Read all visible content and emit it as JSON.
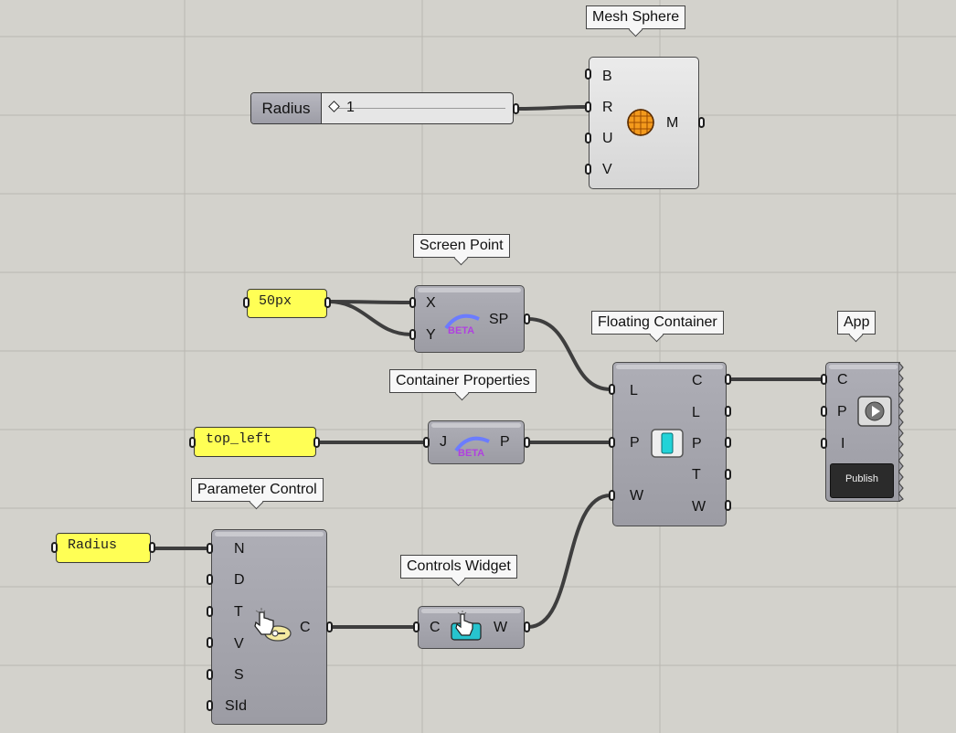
{
  "components": {
    "mesh_sphere": {
      "title": "Mesh Sphere",
      "inputs": [
        "B",
        "R",
        "U",
        "V"
      ],
      "outputs": [
        "M"
      ]
    },
    "radius_slider": {
      "label": "Radius",
      "value": "1"
    },
    "screen_point": {
      "title": "Screen Point",
      "inputs": [
        "X",
        "Y"
      ],
      "outputs": [
        "SP"
      ],
      "badge": "BETA"
    },
    "floating_container": {
      "title": "Floating Container",
      "inputs": [
        "L",
        "P",
        "W"
      ],
      "outputs": [
        "C",
        "L",
        "P",
        "T",
        "W"
      ]
    },
    "app": {
      "title": "App",
      "inputs": [
        "C",
        "P",
        "I"
      ],
      "publish_label": "Publish"
    },
    "container_properties": {
      "title": "Container Properties",
      "inputs": [
        "J"
      ],
      "outputs": [
        "P"
      ],
      "badge": "BETA"
    },
    "parameter_control": {
      "title": "Parameter Control",
      "inputs": [
        "N",
        "D",
        "T",
        "V",
        "S",
        "SId"
      ],
      "outputs": [
        "C"
      ]
    },
    "controls_widget": {
      "title": "Controls Widget",
      "inputs": [
        "C"
      ],
      "outputs": [
        "W"
      ]
    }
  },
  "panels": {
    "px_panel": "50px",
    "position_panel": "top_left",
    "name_panel": "Radius"
  },
  "icons": {
    "mesh_sphere": "sphere-icon",
    "screen_point": "beta-arc-icon",
    "floating_container": "container-icon",
    "app": "play-icon",
    "parameter_control": "hand-pointer-icon",
    "controls_widget": "hand-widget-icon"
  },
  "colors": {
    "canvas": "#d3d2cc",
    "panel": "#ffff55",
    "wire": "#3e3e3e",
    "beta": "#b040e0"
  }
}
